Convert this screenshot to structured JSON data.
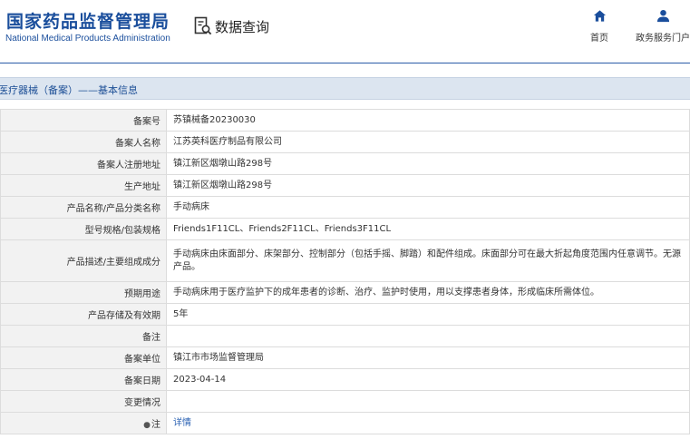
{
  "header": {
    "logo_cn": "国家药品监督管理局",
    "logo_en": "National Medical Products Administration",
    "query_icon": "document-search-icon",
    "query_label": "数据查询",
    "nav": [
      {
        "label": "首页",
        "icon": "home-icon"
      },
      {
        "label": "政务服务门户",
        "icon": "user-icon"
      }
    ],
    "brand_color": "#1a4e9c"
  },
  "section": {
    "title": "医疗器械（备案）——基本信息"
  },
  "rows": [
    {
      "label": "备案号",
      "value": "苏镇械备20230030"
    },
    {
      "label": "备案人名称",
      "value": "江苏英科医疗制品有限公司"
    },
    {
      "label": "备案人注册地址",
      "value": "镇江新区烟墩山路298号"
    },
    {
      "label": "生产地址",
      "value": "镇江新区烟墩山路298号"
    },
    {
      "label": "产品名称/产品分类名称",
      "value": "手动病床"
    },
    {
      "label": "型号规格/包装规格",
      "value": "Friends1F11CL、Friends2F11CL、Friends3F11CL"
    },
    {
      "label": "产品描述/主要组成成分",
      "value": "手动病床由床面部分、床架部分、控制部分（包括手摇、脚踏）和配件组成。床面部分可在最大折起角度范围内任意调节。无源产品。"
    },
    {
      "label": "预期用途",
      "value": "手动病床用于医疗监护下的成年患者的诊断、治疗、监护时使用，用以支撑患者身体，形成临床所需体位。"
    },
    {
      "label": "产品存储及有效期",
      "value": "5年"
    },
    {
      "label": "备注",
      "value": ""
    },
    {
      "label": "备案单位",
      "value": "镇江市市场监督管理局"
    },
    {
      "label": "备案日期",
      "value": "2023-04-14"
    },
    {
      "label": "变更情况",
      "value": ""
    },
    {
      "label": "注",
      "value": "详情",
      "icon": "pin-icon"
    }
  ]
}
